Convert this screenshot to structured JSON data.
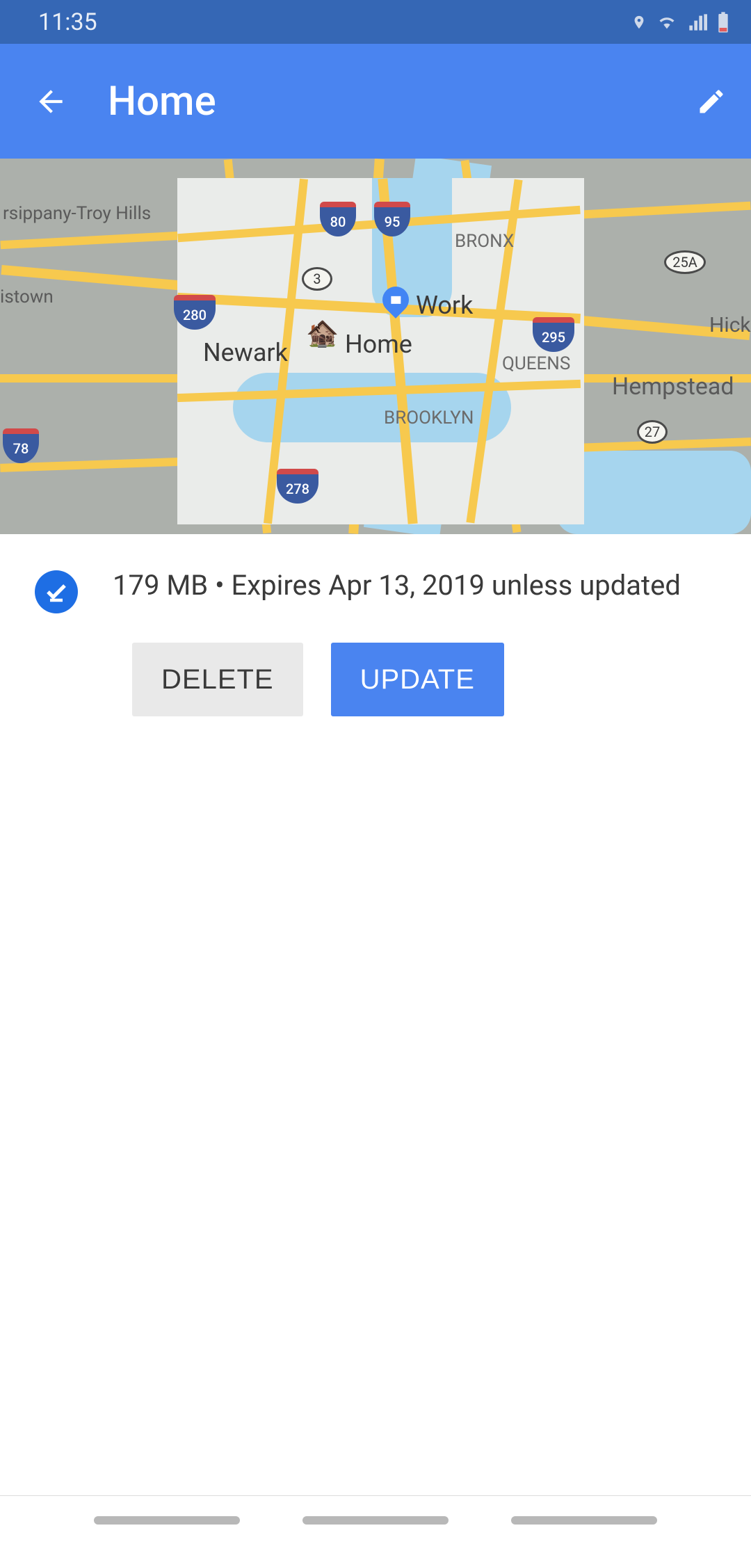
{
  "status": {
    "time": "11:35"
  },
  "header": {
    "title": "Home"
  },
  "map": {
    "labels": {
      "newark": "Newark",
      "home": "Home",
      "work": "Work",
      "brooklyn": "BROOKLYN",
      "queens": "QUEENS",
      "bronx": "BRONX",
      "hempstead": "Hempstead",
      "hicksville": "Hicks",
      "parsippany": "rsippany-Troy Hills",
      "istown": "istown"
    },
    "shields": {
      "i80": "80",
      "i95": "95",
      "i280": "280",
      "i295": "295",
      "i278": "278",
      "i78": "78",
      "r3": "3",
      "r25a": "25A",
      "r27": "27"
    }
  },
  "info": {
    "status_text": "179 MB • Expires Apr 13, 2019 unless updated"
  },
  "buttons": {
    "delete": "DELETE",
    "update": "UPDATE"
  }
}
